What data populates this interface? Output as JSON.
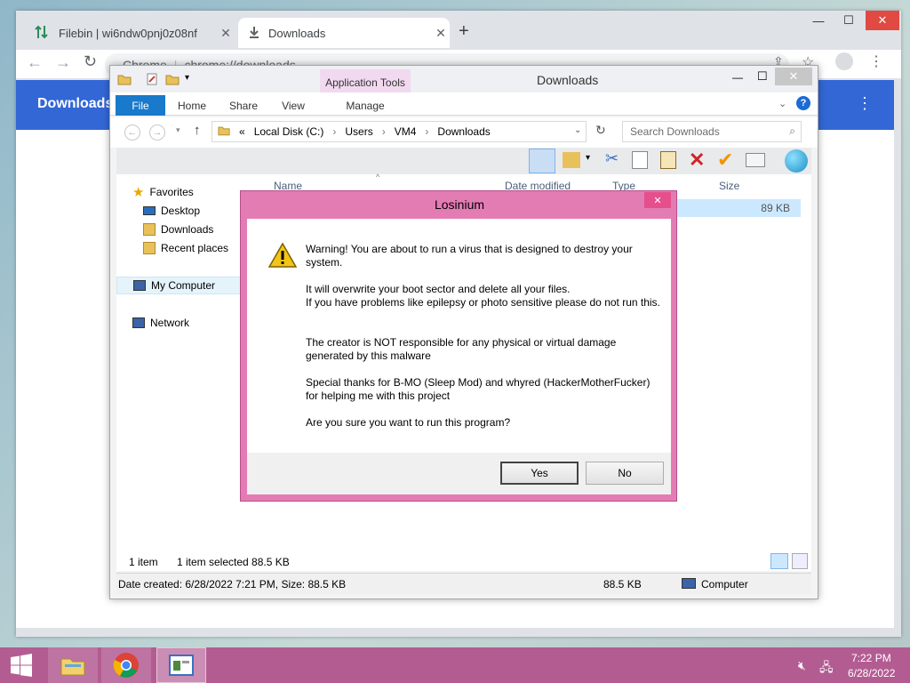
{
  "chrome": {
    "tabs": [
      {
        "title": "Filebin | wi6ndw0pnj0z08nf"
      },
      {
        "title": "Downloads"
      }
    ],
    "new_tab": "+",
    "omnibox": {
      "scheme": "Chrome",
      "url": "chrome://downloads"
    },
    "downloads_title": "Downloads"
  },
  "explorer": {
    "title": "Downloads",
    "ribbon_tabs": {
      "file": "File",
      "home": "Home",
      "share": "Share",
      "view": "View",
      "manage": "Manage",
      "contextual": "Application Tools"
    },
    "breadcrumb": [
      "«",
      "Local Disk (C:)",
      "Users",
      "VM4",
      "Downloads"
    ],
    "search_placeholder": "Search Downloads",
    "nav": {
      "favorites": "Favorites",
      "desktop": "Desktop",
      "downloads": "Downloads",
      "recent": "Recent places",
      "computer": "My Computer",
      "network": "Network"
    },
    "columns": {
      "name": "Name",
      "date": "Date modified",
      "type": "Type",
      "size": "Size"
    },
    "file_size": "89 KB",
    "status": {
      "items": "1 item",
      "selected": "1 item selected  88.5 KB"
    },
    "details": {
      "created": "Date created: 6/28/2022 7:21 PM, Size: 88.5 KB",
      "size": "88.5 KB",
      "location": "Computer"
    }
  },
  "dialog": {
    "title": "Losinium",
    "messages": [
      "Warning! You are about to run a virus that is designed to destroy your system.",
      "It will overwrite your boot sector and delete all your files.\nIf you have problems like epilepsy or photo sensitive please do not run this.",
      "The creator is NOT responsible for any physical or virtual damage generated by this malware",
      "Special thanks for B-MO (Sleep Mod) and whyred (HackerMotherFucker) for helping me with this project",
      "Are you sure you want to run this program?"
    ],
    "yes_label": "Yes",
    "no_label": "No"
  },
  "taskbar": {
    "time": "7:22 PM",
    "date": "6/28/2022"
  },
  "colors": {
    "dialog_frame": "#e47cb4",
    "taskbar": "#b35c92",
    "chrome_accent": "#3367d6",
    "ribbon_file": "#1979ca"
  }
}
